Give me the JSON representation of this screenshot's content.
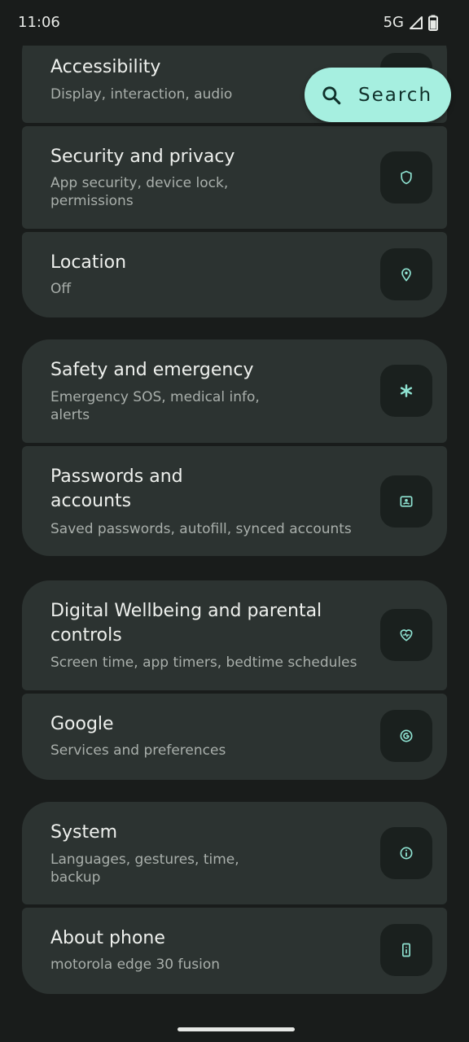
{
  "status_bar": {
    "time": "11:06",
    "network": "5G",
    "icons": [
      "signal-icon",
      "battery-icon"
    ]
  },
  "search": {
    "label": "Search",
    "icon": "search-icon"
  },
  "groups": [
    {
      "items": [
        {
          "title": "Accessibility",
          "subtitle": "Display, interaction, audio",
          "icon": "accessibility-icon"
        },
        {
          "title": "Security and privacy",
          "subtitle": "App security, device lock, permissions",
          "icon": "shield-icon"
        },
        {
          "title": "Location",
          "subtitle": "Off",
          "icon": "location-pin-icon"
        }
      ]
    },
    {
      "items": [
        {
          "title": "Safety and emergency",
          "subtitle": "Emergency SOS, medical info, alerts",
          "icon": "asterisk-icon"
        },
        {
          "title": "Passwords and accounts",
          "subtitle": "Saved passwords, autofill, synced accounts",
          "icon": "account-box-icon"
        }
      ]
    },
    {
      "items": [
        {
          "title": "Digital Wellbeing and parental controls",
          "subtitle": "Screen time, app timers, bedtime schedules",
          "icon": "heart-icon"
        },
        {
          "title": "Google",
          "subtitle": "Services and preferences",
          "icon": "google-icon"
        }
      ]
    },
    {
      "items": [
        {
          "title": "System",
          "subtitle": "Languages, gestures, time, backup",
          "icon": "info-icon"
        },
        {
          "title": "About phone",
          "subtitle": "motorola edge 30 fusion",
          "icon": "phone-info-icon"
        }
      ]
    }
  ],
  "colors": {
    "background": "#191c1b",
    "card": "#2c3331",
    "accent": "#a6efe0",
    "icon_tint": "#8fe3d2"
  }
}
